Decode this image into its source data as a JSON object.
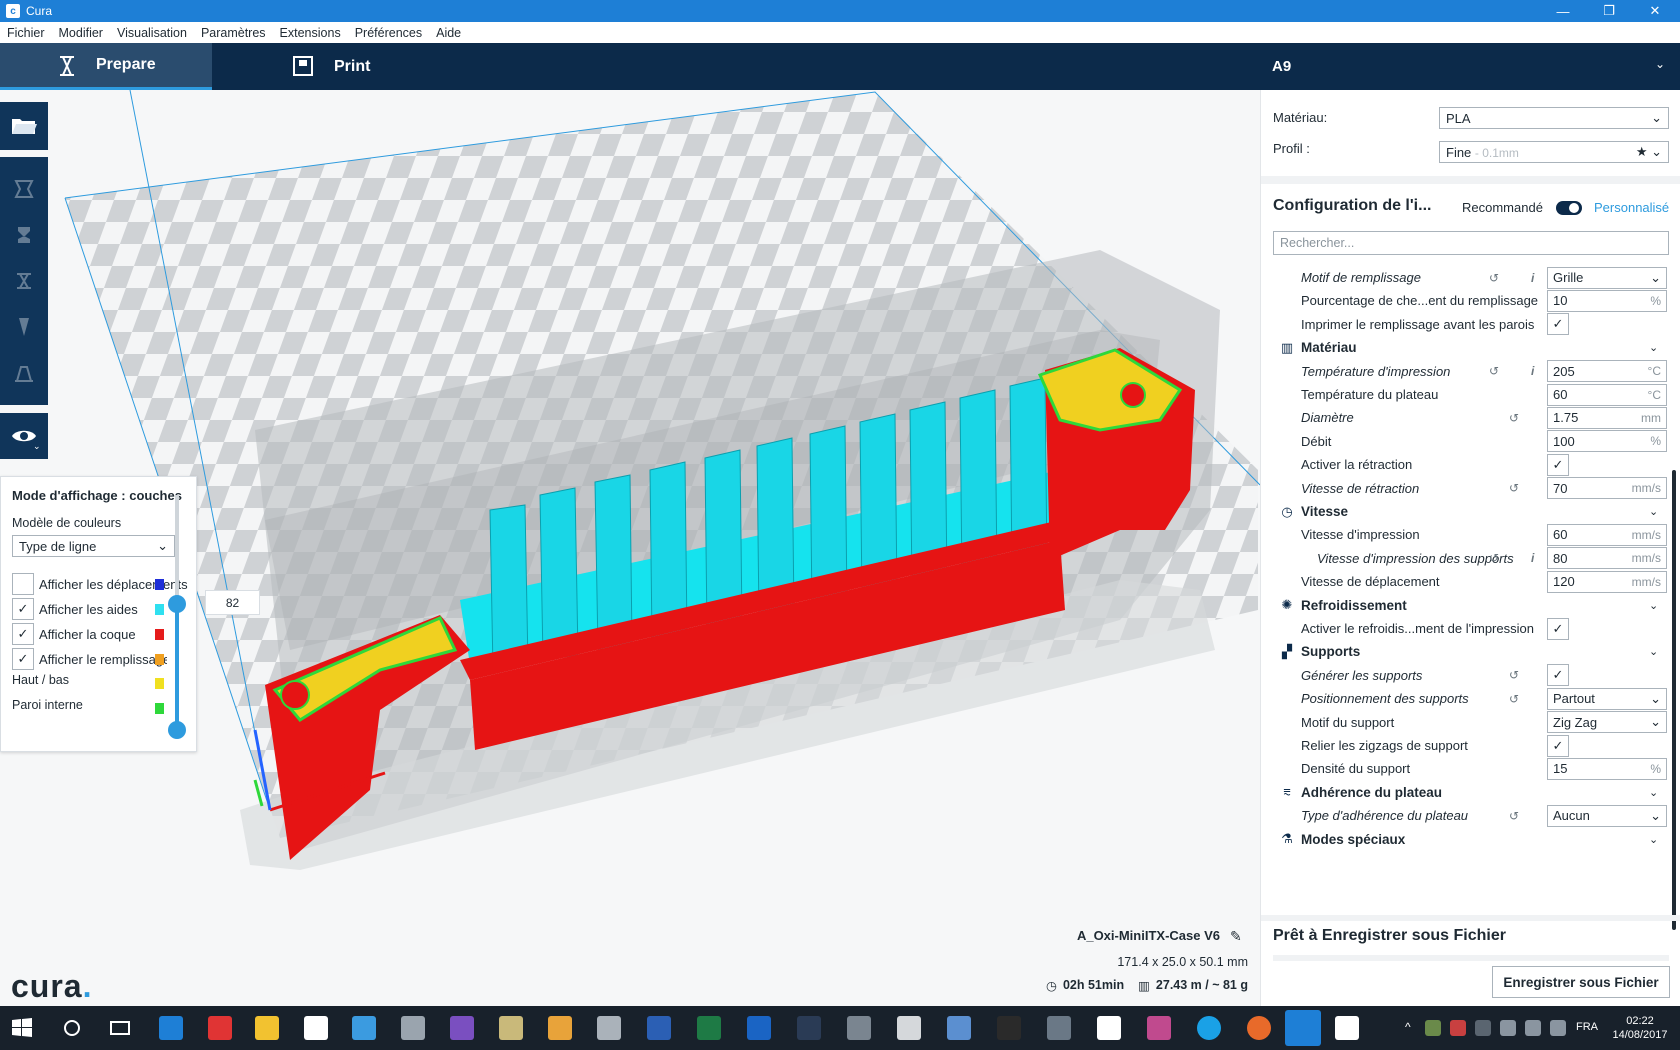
{
  "window": {
    "title": "Cura"
  },
  "menu": [
    "Fichier",
    "Modifier",
    "Visualisation",
    "Paramètres",
    "Extensions",
    "Préférences",
    "Aide"
  ],
  "tabs": {
    "prepare": "Prepare",
    "print": "Print"
  },
  "printer": {
    "name": "A9"
  },
  "material": {
    "label": "Matériau:",
    "value": "PLA"
  },
  "profile": {
    "label": "Profil :",
    "value": "Fine",
    "hint": "- 0.1mm"
  },
  "setup": {
    "title": "Configuration de l'i...",
    "recommended": "Recommandé",
    "custom": "Personnalisé",
    "search_placeholder": "Rechercher..."
  },
  "layer_view": {
    "title": "Mode d'affichage : couches",
    "color_model_label": "Modèle de couleurs",
    "color_model_value": "Type de ligne",
    "options": [
      {
        "label": "Afficher les déplacements",
        "checked": false,
        "color": "#1f2fd8"
      },
      {
        "label": "Afficher les aides",
        "checked": true,
        "color": "#2fe0f0"
      },
      {
        "label": "Afficher la coque",
        "checked": true,
        "color": "#e51b1b"
      },
      {
        "label": "Afficher le remplissage",
        "checked": true,
        "color": "#f0a020"
      }
    ],
    "legend": [
      {
        "label": "Haut / bas",
        "color": "#f0e020"
      },
      {
        "label": "Paroi interne",
        "color": "#2ed83a"
      }
    ],
    "current_layer": "82"
  },
  "settings": {
    "infill": [
      {
        "label": "Motif de remplissage",
        "italic": true,
        "reset": true,
        "info": true,
        "type": "select",
        "value": "Grille"
      },
      {
        "label": "Pourcentage de che...ent du remplissage",
        "type": "number",
        "value": "10",
        "unit": "%"
      },
      {
        "label": "Imprimer le remplissage avant les parois",
        "type": "check",
        "checked": true
      }
    ],
    "categories": [
      {
        "name": "Matériau",
        "icon": "material-icon",
        "rows": [
          {
            "label": "Température d'impression",
            "italic": true,
            "reset": true,
            "info": true,
            "type": "number",
            "value": "205",
            "unit": "°C"
          },
          {
            "label": "Température du plateau",
            "type": "number",
            "value": "60",
            "unit": "°C"
          },
          {
            "label": "Diamètre",
            "italic": true,
            "reset": true,
            "type": "number",
            "value": "1.75",
            "unit": "mm"
          },
          {
            "label": "Débit",
            "type": "number",
            "value": "100",
            "unit": "%"
          },
          {
            "label": "Activer la rétraction",
            "type": "check",
            "checked": true
          },
          {
            "label": "Vitesse de rétraction",
            "italic": true,
            "reset": true,
            "type": "number",
            "value": "70",
            "unit": "mm/s"
          }
        ]
      },
      {
        "name": "Vitesse",
        "icon": "speed-icon",
        "rows": [
          {
            "label": "Vitesse d'impression",
            "type": "number",
            "value": "60",
            "unit": "mm/s"
          },
          {
            "label": "Vitesse d'impression des supports",
            "italic": true,
            "indent": true,
            "reset": true,
            "info": true,
            "type": "number",
            "value": "80",
            "unit": "mm/s"
          },
          {
            "label": "Vitesse de déplacement",
            "type": "number",
            "value": "120",
            "unit": "mm/s"
          }
        ]
      },
      {
        "name": "Refroidissement",
        "icon": "cooling-icon",
        "rows": [
          {
            "label": "Activer le refroidis...ment de l'impression",
            "type": "check",
            "checked": true
          }
        ]
      },
      {
        "name": "Supports",
        "icon": "support-icon",
        "rows": [
          {
            "label": "Générer les supports",
            "italic": true,
            "reset": true,
            "type": "check",
            "checked": true
          },
          {
            "label": "Positionnement des supports",
            "italic": true,
            "reset": true,
            "type": "select",
            "value": "Partout"
          },
          {
            "label": "Motif du support",
            "type": "select",
            "value": "Zig Zag"
          },
          {
            "label": "Relier les zigzags de support",
            "type": "check",
            "checked": true
          },
          {
            "label": "Densité du support",
            "type": "number",
            "value": "15",
            "unit": "%"
          }
        ]
      },
      {
        "name": "Adhérence du plateau",
        "icon": "adhesion-icon",
        "rows": [
          {
            "label": "Type d'adhérence du plateau",
            "italic": true,
            "reset": true,
            "type": "select",
            "value": "Aucun"
          }
        ]
      },
      {
        "name": "Modes spéciaux",
        "icon": "special-modes-icon",
        "rows": []
      }
    ]
  },
  "save": {
    "title": "Prêt à Enregistrer sous Fichier",
    "button": "Enregistrer sous Fichier"
  },
  "model": {
    "name": "A_Oxi-MiniITX-Case V6",
    "dimensions": "171.4 x 25.0 x 50.1 mm",
    "time": "02h 51min",
    "material_usage": "27.43 m / ~ 81 g"
  },
  "logo": "cura",
  "taskbar": {
    "lang": "FRA",
    "time": "02:22",
    "date": "14/08/2017"
  }
}
